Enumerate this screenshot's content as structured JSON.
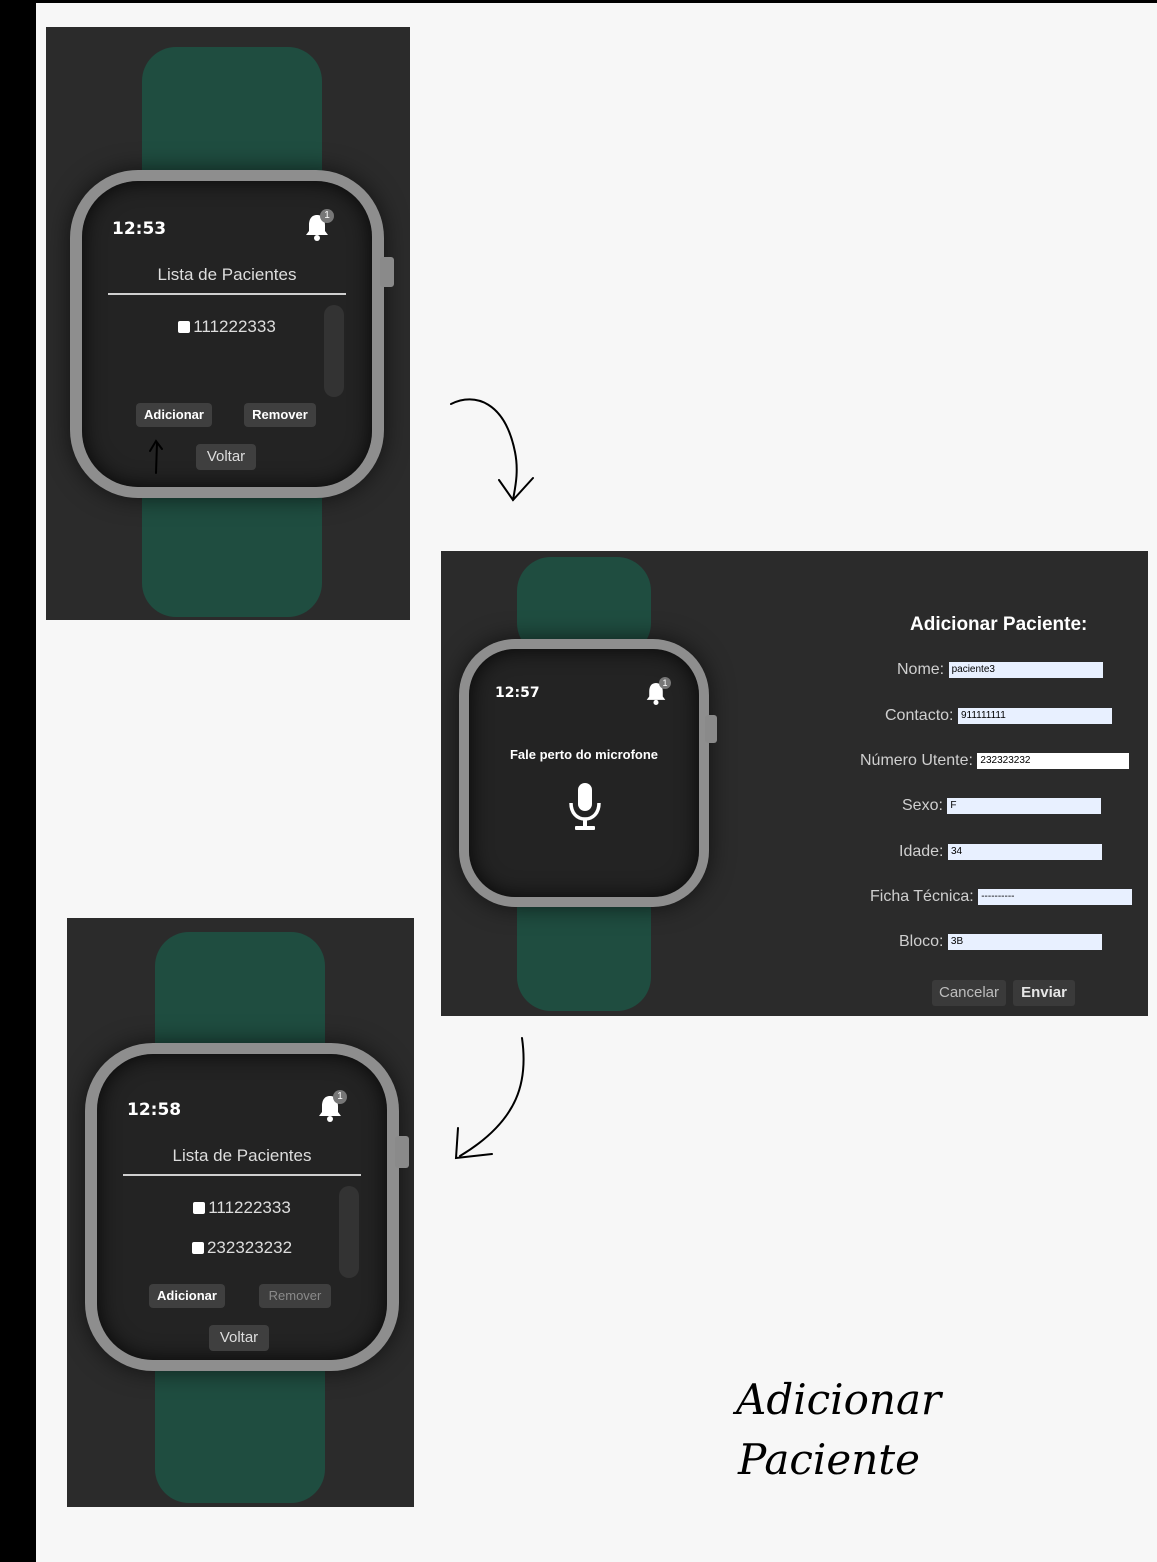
{
  "screen1": {
    "time": "12:53",
    "badge": "1",
    "title": "Lista de Pacientes",
    "items": [
      "111222333"
    ],
    "add_label": "Adicionar",
    "remove_label": "Remover",
    "back_label": "Voltar"
  },
  "screen2": {
    "time": "12:57",
    "badge": "1",
    "prompt": "Fale perto do microfone",
    "form": {
      "title": "Adicionar Paciente:",
      "fields": [
        {
          "label": "Nome:",
          "value": "paciente3"
        },
        {
          "label": "Contacto:",
          "value": "911111111"
        },
        {
          "label": "Número Utente:",
          "value": "232323232"
        },
        {
          "label": "Sexo:",
          "value": "F"
        },
        {
          "label": "Idade:",
          "value": "34"
        },
        {
          "label": "Ficha Técnica:",
          "value": "----------"
        },
        {
          "label": "Bloco:",
          "value": "3B"
        }
      ],
      "cancel_label": "Cancelar",
      "submit_label": "Enviar"
    }
  },
  "screen3": {
    "time": "12:58",
    "badge": "1",
    "title": "Lista de Pacientes",
    "items": [
      "111222333",
      "232323232"
    ],
    "add_label": "Adicionar",
    "remove_label": "Remover",
    "back_label": "Voltar"
  },
  "note": {
    "line1": "Adicionar",
    "line2": "Paciente"
  },
  "colors": {
    "panel": "#2b2b2b",
    "strap": "#1f4d40",
    "case": "#8e8e8e",
    "screen": "#232323",
    "input": "#e8f0ff"
  }
}
